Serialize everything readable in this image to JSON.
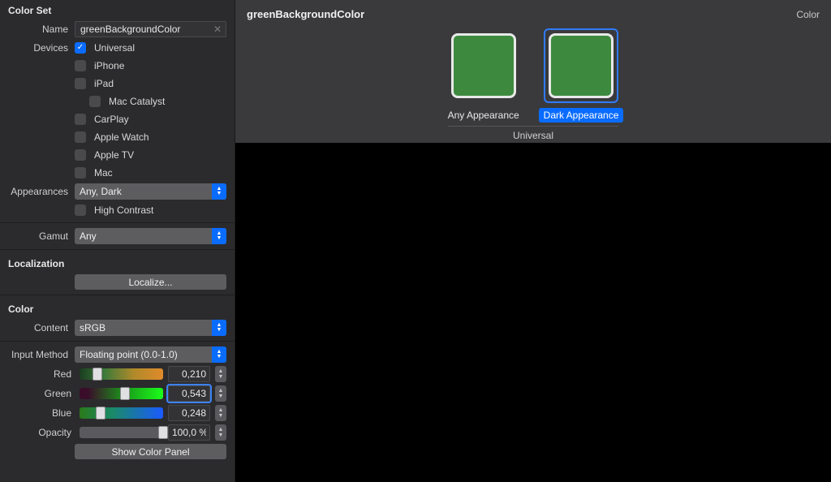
{
  "panel": {
    "colorSet": {
      "header": "Color Set",
      "nameLabel": "Name",
      "name": "greenBackgroundColor",
      "devicesLabel": "Devices",
      "devices": [
        {
          "label": "Universal",
          "checked": true,
          "indent": 1
        },
        {
          "label": "iPhone",
          "checked": false,
          "indent": 1
        },
        {
          "label": "iPad",
          "checked": false,
          "indent": 1
        },
        {
          "label": "Mac Catalyst",
          "checked": false,
          "indent": 2
        },
        {
          "label": "CarPlay",
          "checked": false,
          "indent": 1
        },
        {
          "label": "Apple Watch",
          "checked": false,
          "indent": 1
        },
        {
          "label": "Apple TV",
          "checked": false,
          "indent": 1
        },
        {
          "label": "Mac",
          "checked": false,
          "indent": 1
        }
      ],
      "appearancesLabel": "Appearances",
      "appearances": "Any, Dark",
      "highContrast": {
        "label": "High Contrast",
        "checked": false
      },
      "gamutLabel": "Gamut",
      "gamut": "Any"
    },
    "localization": {
      "header": "Localization",
      "button": "Localize..."
    },
    "color": {
      "header": "Color",
      "contentLabel": "Content",
      "content": "sRGB",
      "inputMethodLabel": "Input Method",
      "inputMethod": "Floating point (0.0-1.0)",
      "channels": {
        "red": {
          "label": "Red",
          "value": "0,210",
          "pos": 21
        },
        "green": {
          "label": "Green",
          "value": "0,543",
          "pos": 54
        },
        "blue": {
          "label": "Blue",
          "value": "0,248",
          "pos": 25
        },
        "opacity": {
          "label": "Opacity",
          "value": "100,0 %",
          "pos": 100
        }
      },
      "showPanel": "Show Color Panel"
    }
  },
  "preview": {
    "title": "greenBackgroundColor",
    "type": "Color",
    "swatchColor": "#3d8a3f",
    "swatches": [
      {
        "label": "Any Appearance",
        "selected": false
      },
      {
        "label": "Dark Appearance",
        "selected": true
      }
    ],
    "groupLabel": "Universal"
  }
}
